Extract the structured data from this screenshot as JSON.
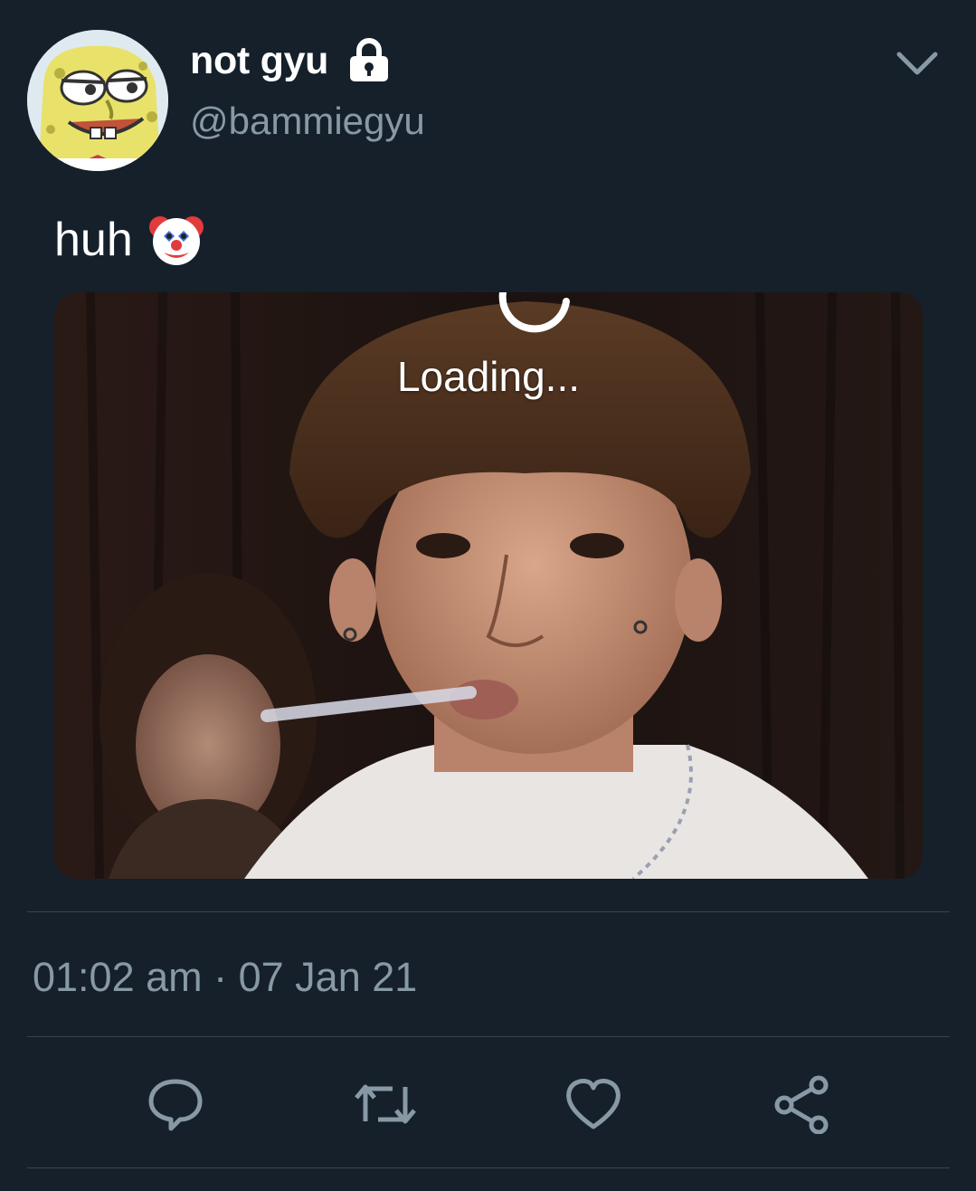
{
  "author": {
    "display_name": "not gyu",
    "handle": "@bammiegyu",
    "protected": true,
    "avatar_icon": "spongebob-avatar"
  },
  "tweet": {
    "text": "huh",
    "emoji": "clown-face-icon",
    "media": {
      "overlay_text": "Loading..."
    },
    "timestamp": "01:02 am · 07 Jan 21"
  },
  "actions": [
    {
      "name": "reply",
      "icon": "reply-icon"
    },
    {
      "name": "retweet",
      "icon": "retweet-icon"
    },
    {
      "name": "like",
      "icon": "heart-icon"
    },
    {
      "name": "share",
      "icon": "share-icon"
    }
  ],
  "colors": {
    "background": "#15202b",
    "secondary_text": "#8899a6",
    "divider": "#38444d"
  }
}
